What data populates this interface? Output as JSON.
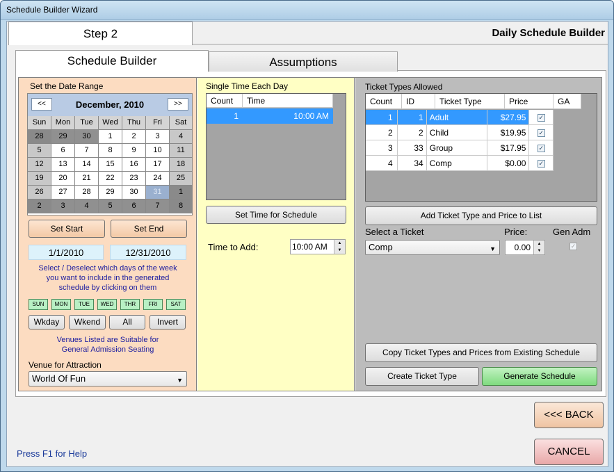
{
  "window": {
    "title": "Schedule Builder Wizard"
  },
  "header": {
    "step": "Step 2",
    "title": "Daily Schedule Builder"
  },
  "tabs": [
    {
      "label": "Schedule Builder",
      "active": true
    },
    {
      "label": "Assumptions",
      "active": false
    }
  ],
  "date_range": {
    "label": "Set the Date Range",
    "calendar": {
      "prev": "<<",
      "next": ">>",
      "month": "December, 2010",
      "dows": [
        "Sun",
        "Mon",
        "Tue",
        "Wed",
        "Thu",
        "Fri",
        "Sat"
      ],
      "weeks": [
        [
          "28",
          "29",
          "30",
          "1",
          "2",
          "3",
          "4"
        ],
        [
          "5",
          "6",
          "7",
          "8",
          "9",
          "10",
          "11"
        ],
        [
          "12",
          "13",
          "14",
          "15",
          "16",
          "17",
          "18"
        ],
        [
          "19",
          "20",
          "21",
          "22",
          "23",
          "24",
          "25"
        ],
        [
          "26",
          "27",
          "28",
          "29",
          "30",
          "31",
          "1"
        ],
        [
          "2",
          "3",
          "4",
          "5",
          "6",
          "7",
          "8"
        ]
      ],
      "selected_day": "31"
    },
    "set_start": "Set Start",
    "set_end": "Set End",
    "start": "1/1/2010",
    "end": "12/31/2010",
    "note1_line1": "Select / Deselect which days of the week",
    "note1_line2": "you want to include in the generated",
    "note1_line3": "schedule by clicking on them",
    "days": [
      "SUN",
      "MON",
      "TUE",
      "WED",
      "THR",
      "FRI",
      "SAT"
    ],
    "wkday": "Wkday",
    "wkend": "Wkend",
    "all": "All",
    "invert": "Invert",
    "note2_line1": "Venues Listed are Suitable for",
    "note2_line2": "General Admission Seating",
    "venue_label": "Venue for Attraction",
    "venue_value": "World Of Fun"
  },
  "single_time": {
    "label": "Single Time Each Day",
    "col_count": "Count",
    "col_time": "Time",
    "rows": [
      {
        "count": "1",
        "time": "10:00 AM"
      }
    ],
    "set_time_btn": "Set Time for Schedule",
    "time_to_add_label": "Time to Add:",
    "time_to_add": "10:00 AM"
  },
  "tickets": {
    "label": "Ticket Types Allowed",
    "headers": {
      "count": "Count",
      "id": "ID",
      "type": "Ticket Type",
      "price": "Price",
      "ga": "GA"
    },
    "rows": [
      {
        "count": "1",
        "id": "1",
        "type": "Adult",
        "price": "$27.95",
        "ga": "✓"
      },
      {
        "count": "2",
        "id": "2",
        "type": "Child",
        "price": "$19.95",
        "ga": "✓"
      },
      {
        "count": "3",
        "id": "33",
        "type": "Group",
        "price": "$17.95",
        "ga": "✓"
      },
      {
        "count": "4",
        "id": "34",
        "type": "Comp",
        "price": "$0.00",
        "ga": "✓"
      }
    ],
    "add_btn": "Add Ticket Type and Price to List",
    "select_label": "Select a Ticket",
    "price_label": "Price:",
    "genadm_label": "Gen Adm",
    "select_value": "Comp",
    "price_value": "0.00",
    "genadm_check": "✓",
    "copy_btn": "Copy Ticket Types and Prices from Existing Schedule",
    "create_btn": "Create Ticket Type",
    "generate_btn": "Generate Schedule"
  },
  "footer": {
    "help": "Press F1 for Help",
    "back": "<<< BACK",
    "cancel": "CANCEL"
  }
}
